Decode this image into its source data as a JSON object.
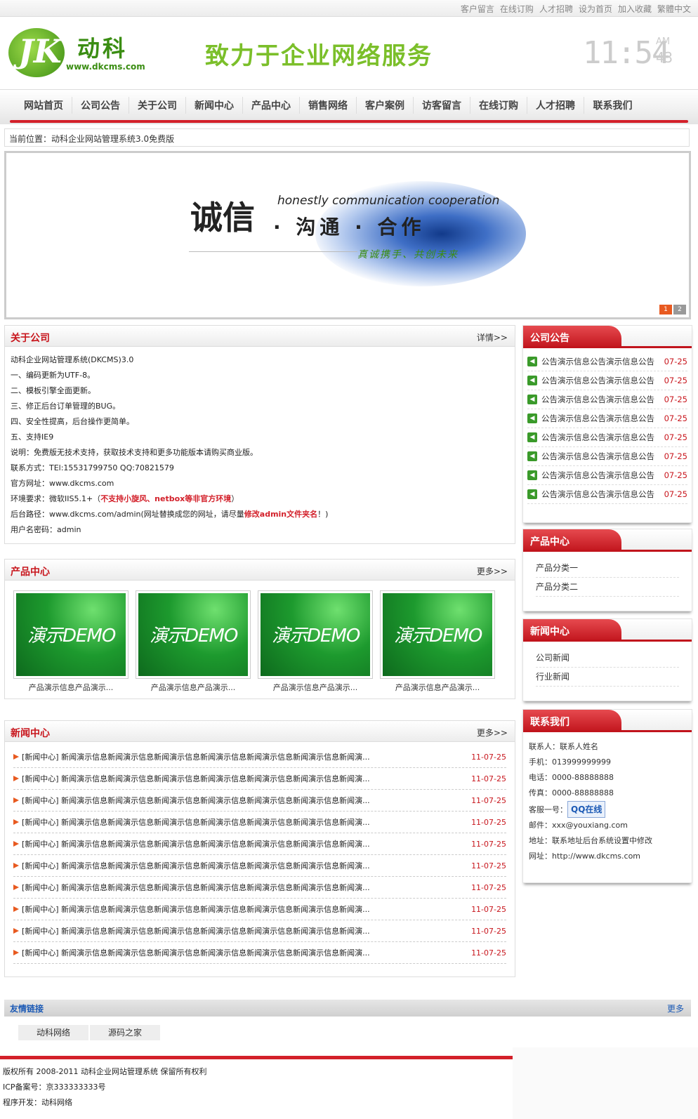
{
  "toplinks": [
    "客户留言",
    "在线订购",
    "人才招聘",
    "设为首页",
    "加入收藏",
    "繁體中文"
  ],
  "logo": {
    "mark": "JK",
    "name": "动科",
    "url": "www.dkcms.com"
  },
  "slogan": "致力于企业网络服务",
  "clock": {
    "time": "11:54",
    "ampm": "AM",
    "seconds": "43"
  },
  "nav": [
    "网站首页",
    "公司公告",
    "关于公司",
    "新闻中心",
    "产品中心",
    "销售网络",
    "客户案例",
    "访客留言",
    "在线订购",
    "人才招聘",
    "联系我们"
  ],
  "breadcrumb": "当前位置：动科企业网站管理系统3.0免费版",
  "banner": {
    "title": "诚信",
    "english": "honestly communication cooperation",
    "subtitle": "· 沟通 · 合作",
    "tagline": "真诚携手、共创未来",
    "pages": [
      "1",
      "2"
    ]
  },
  "about": {
    "title": "关于公司",
    "more": "详情>>",
    "lines": [
      "动科企业网站管理系统(DKCMS)3.0",
      "一、编码更新为UTF-8。",
      "二、模板引擎全面更新。",
      "三、修正后台订单管理的BUG。",
      "四、安全性提高，后台操作更简单。",
      "五、支持IE9",
      "说明：免费版无技术支持，获取技术支持和更多功能版本请购买商业版。",
      "联系方式：TEl:15531799750 QQ:70821579",
      "官方网址：www.dkcms.com"
    ],
    "env_prefix": "环境要求：微软IIS5.1+（",
    "env_red": "不支持小旋风、netbox等非官方环境",
    "env_suffix": "）",
    "path_prefix": "后台路径：www.dkcms.com/admin(网址替换成您的网址，请尽量",
    "path_red": "修改admin文件夹名",
    "path_suffix": "！)",
    "account": "用户名密码：admin"
  },
  "products": {
    "title": "产品中心",
    "more": "更多>>",
    "items": [
      {
        "img_text": "演示DEMO",
        "caption": "产品演示信息产品演示..."
      },
      {
        "img_text": "演示DEMO",
        "caption": "产品演示信息产品演示..."
      },
      {
        "img_text": "演示DEMO",
        "caption": "产品演示信息产品演示..."
      },
      {
        "img_text": "演示DEMO",
        "caption": "产品演示信息产品演示..."
      }
    ]
  },
  "news": {
    "title": "新闻中心",
    "more": "更多>>",
    "items": [
      {
        "text": "[新闻中心] 新闻演示信息新闻演示信息新闻演示信息新闻演示信息新闻演示信息新闻演示信息新闻演...",
        "date": "11-07-25"
      },
      {
        "text": "[新闻中心] 新闻演示信息新闻演示信息新闻演示信息新闻演示信息新闻演示信息新闻演示信息新闻演...",
        "date": "11-07-25"
      },
      {
        "text": "[新闻中心] 新闻演示信息新闻演示信息新闻演示信息新闻演示信息新闻演示信息新闻演示信息新闻演...",
        "date": "11-07-25"
      },
      {
        "text": "[新闻中心] 新闻演示信息新闻演示信息新闻演示信息新闻演示信息新闻演示信息新闻演示信息新闻演...",
        "date": "11-07-25"
      },
      {
        "text": "[新闻中心] 新闻演示信息新闻演示信息新闻演示信息新闻演示信息新闻演示信息新闻演示信息新闻演...",
        "date": "11-07-25"
      },
      {
        "text": "[新闻中心] 新闻演示信息新闻演示信息新闻演示信息新闻演示信息新闻演示信息新闻演示信息新闻演...",
        "date": "11-07-25"
      },
      {
        "text": "[新闻中心] 新闻演示信息新闻演示信息新闻演示信息新闻演示信息新闻演示信息新闻演示信息新闻演...",
        "date": "11-07-25"
      },
      {
        "text": "[新闻中心] 新闻演示信息新闻演示信息新闻演示信息新闻演示信息新闻演示信息新闻演示信息新闻演...",
        "date": "11-07-25"
      },
      {
        "text": "[新闻中心] 新闻演示信息新闻演示信息新闻演示信息新闻演示信息新闻演示信息新闻演示信息新闻演...",
        "date": "11-07-25"
      },
      {
        "text": "[新闻中心] 新闻演示信息新闻演示信息新闻演示信息新闻演示信息新闻演示信息新闻演示信息新闻演...",
        "date": "11-07-25"
      }
    ]
  },
  "notice": {
    "title": "公司公告",
    "items": [
      {
        "text": "公告演示信息公告演示信息公告",
        "date": "07-25"
      },
      {
        "text": "公告演示信息公告演示信息公告",
        "date": "07-25"
      },
      {
        "text": "公告演示信息公告演示信息公告",
        "date": "07-25"
      },
      {
        "text": "公告演示信息公告演示信息公告",
        "date": "07-25"
      },
      {
        "text": "公告演示信息公告演示信息公告",
        "date": "07-25"
      },
      {
        "text": "公告演示信息公告演示信息公告",
        "date": "07-25"
      },
      {
        "text": "公告演示信息公告演示信息公告",
        "date": "07-25"
      },
      {
        "text": "公告演示信息公告演示信息公告",
        "date": "07-25"
      }
    ]
  },
  "product_categories": {
    "title": "产品中心",
    "items": [
      "产品分类一",
      "产品分类二"
    ]
  },
  "news_categories": {
    "title": "新闻中心",
    "items": [
      "公司新闻",
      "行业新闻"
    ]
  },
  "contact": {
    "title": "联系我们",
    "person": "联系人：联系人姓名",
    "mobile": "手机：013999999999",
    "phone": "电话：0000-88888888",
    "fax": "传真：0000-88888888",
    "service_label": "客服一号：",
    "qq_button": "QQ在线",
    "email": "邮件：xxx@youxiang.com",
    "address": "地址：联系地址后台系统设置中修改",
    "website": "网址：http://www.dkcms.com"
  },
  "friend_links": {
    "title": "友情链接",
    "more": "更多",
    "items": [
      "动科网络",
      "源码之家"
    ]
  },
  "footer": {
    "copyright": "版权所有 2008-2011 动科企业网站管理系统 保留所有权利",
    "icp": "ICP备案号：京333333333号",
    "developer": "程序开发：动科网络"
  }
}
